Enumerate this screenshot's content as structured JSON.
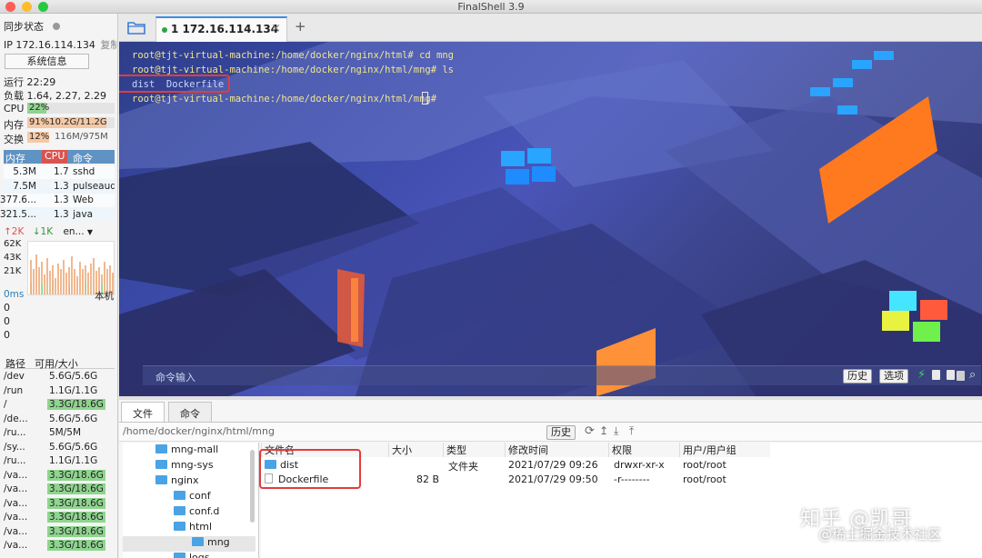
{
  "window": {
    "title": "FinalShell 3.9"
  },
  "sidebar": {
    "sync_label": "同步状态",
    "ip_label": "IP 172.16.114.134",
    "copy_label": "复制",
    "sysinfo_button": "系统信息",
    "uptime": "运行 22:29",
    "load": "负载 1.64, 2.27, 2.29",
    "cpu": {
      "label": "CPU",
      "value": "22%",
      "percent": 22
    },
    "mem": {
      "label": "内存",
      "value": "91%10.2G/11.2G",
      "percent": 91
    },
    "swap": {
      "label": "交换",
      "pct": "12%",
      "value": "116M/975M",
      "percent": 12
    },
    "proc_headers": [
      "内存",
      "CPU",
      "命令"
    ],
    "processes": [
      {
        "mem": "5.3M",
        "cpu": "1.7",
        "cmd": "sshd"
      },
      {
        "mem": "7.5M",
        "cpu": "1.3",
        "cmd": "pulseaudi"
      },
      {
        "mem": "377.6...",
        "cpu": "1.3",
        "cmd": "Web"
      },
      {
        "mem": "321.5...",
        "cpu": "1.3",
        "cmd": "java"
      }
    ],
    "net": {
      "up": "↑2K",
      "down": "↓1K",
      "iface": "en...",
      "ticks": [
        "62K",
        "43K",
        "21K"
      ]
    },
    "ping": {
      "value": "0ms",
      "target": "本机",
      "values": [
        "0",
        "0",
        "0"
      ]
    },
    "disk_headers": [
      "路径",
      "可用/大小"
    ],
    "disks": [
      {
        "path": "/dev",
        "size": "5.6G/5.6G",
        "hl": false
      },
      {
        "path": "/run",
        "size": "1.1G/1.1G",
        "hl": false
      },
      {
        "path": "/",
        "size": "3.3G/18.6G",
        "hl": true
      },
      {
        "path": "/de...",
        "size": "5.6G/5.6G",
        "hl": false
      },
      {
        "path": "/ru...",
        "size": "5M/5M",
        "hl": false
      },
      {
        "path": "/sy...",
        "size": "5.6G/5.6G",
        "hl": false
      },
      {
        "path": "/ru...",
        "size": "1.1G/1.1G",
        "hl": false
      },
      {
        "path": "/va...",
        "size": "3.3G/18.6G",
        "hl": true
      },
      {
        "path": "/va...",
        "size": "3.3G/18.6G",
        "hl": true
      },
      {
        "path": "/va...",
        "size": "3.3G/18.6G",
        "hl": true
      },
      {
        "path": "/va...",
        "size": "3.3G/18.6G",
        "hl": true
      },
      {
        "path": "/va...",
        "size": "3.3G/18.6G",
        "hl": true
      },
      {
        "path": "/va...",
        "size": "3.3G/18.6G",
        "hl": true
      }
    ]
  },
  "tabs": {
    "session_label": "1 172.16.114.134"
  },
  "terminal": {
    "lines": [
      "root@tjt-virtual-machine:/home/docker/nginx/html# cd mng",
      "root@tjt-virtual-machine:/home/docker/nginx/html/mng# ls",
      "dist  Dockerfile",
      "root@tjt-virtual-machine:/home/docker/nginx/html/mng# "
    ],
    "command_placeholder": "命令输入",
    "history_button": "历史",
    "options_button": "选项"
  },
  "files": {
    "tab_files": "文件",
    "tab_commands": "命令",
    "path": "/home/docker/nginx/html/mng",
    "history_button": "历史",
    "tree": [
      {
        "label": "mng-mall",
        "indent": 1
      },
      {
        "label": "mng-sys",
        "indent": 1
      },
      {
        "label": "nginx",
        "indent": 1
      },
      {
        "label": "conf",
        "indent": 2
      },
      {
        "label": "conf.d",
        "indent": 2
      },
      {
        "label": "html",
        "indent": 2
      },
      {
        "label": "mng",
        "indent": 3
      },
      {
        "label": "logs",
        "indent": 2
      }
    ],
    "headers": [
      "文件名",
      "大小",
      "类型",
      "修改时间",
      "权限",
      "用户/用户组"
    ],
    "rows": [
      {
        "name": "dist",
        "size": "",
        "type": "文件夹",
        "mtime": "2021/07/29 09:26",
        "perm": "drwxr-xr-x",
        "owner": "root/root",
        "folder": true
      },
      {
        "name": "Dockerfile",
        "size": "82 B",
        "type": "",
        "mtime": "2021/07/29 09:50",
        "perm": "-r--------",
        "owner": "root/root",
        "folder": false
      }
    ]
  },
  "watermark": {
    "line1": "知乎 @凯哥",
    "line2": "@稀土掘金技术社区"
  }
}
